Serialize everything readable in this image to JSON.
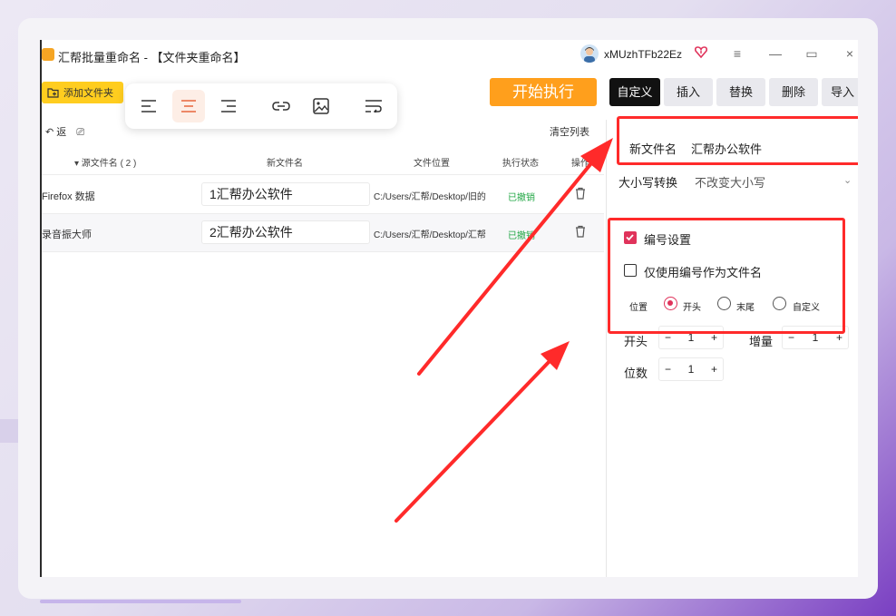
{
  "window": {
    "title": "汇帮批量重命名 - 【文件夹重命名】",
    "username": "xMUzhTFb22Ez",
    "controls": {
      "menu": "≡",
      "minimize": "—",
      "maximize": "▭",
      "close": "×"
    }
  },
  "toolbar": {
    "add_folder": "添加文件夹",
    "start": "开始执行",
    "tabs": [
      "自定义",
      "插入",
      "替换",
      "删除",
      "导入"
    ],
    "active_tab": "自定义",
    "format_icons": [
      "align-left-icon",
      "align-center-icon",
      "align-right-icon",
      "link-icon",
      "image-icon",
      "wrap-text-icon"
    ]
  },
  "list": {
    "back_label": "返",
    "clear_label": "清空列表",
    "headers": {
      "source": "▾ 源文件名 ( 2 )",
      "new": "新文件名",
      "location": "文件位置",
      "status": "执行状态",
      "action": "操作"
    },
    "rows": [
      {
        "source": "Firefox 数据",
        "new": "1汇帮办公软件",
        "location": "C:/Users/汇帮/Desktop/旧的",
        "status": "已撤销"
      },
      {
        "source": "录音振大师",
        "new": "2汇帮办公软件",
        "location": "C:/Users/汇帮/Desktop/汇帮",
        "status": "已撤销"
      }
    ]
  },
  "panel": {
    "new_name_label": "新文件名",
    "new_name_value": "汇帮办公软件",
    "case_label": "大小写转换",
    "case_value": "不改变大小写",
    "numbering_label": "编号设置",
    "numbering_checked": true,
    "only_number_label": "仅使用编号作为文件名",
    "only_number_checked": false,
    "position_label": "位置",
    "position_options": [
      "开头",
      "末尾",
      "自定义"
    ],
    "position_selected": "开头",
    "start_label": "开头",
    "start_value": "1",
    "step_label": "增量",
    "step_value": "1",
    "digits_label": "位数",
    "digits_value": "1",
    "minus": "−",
    "plus": "+"
  },
  "colors": {
    "accent": "#ff9f1c",
    "add_button": "#ffcd1f",
    "checkbox": "#e0335b",
    "annotation": "#ff2a2a",
    "status_green": "#22a745"
  }
}
